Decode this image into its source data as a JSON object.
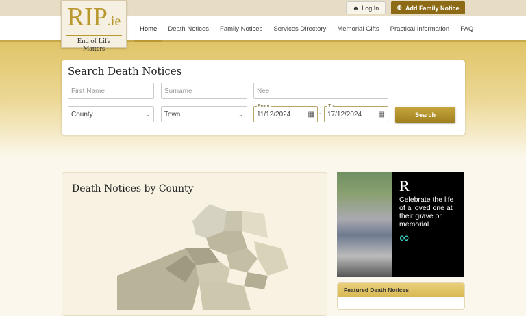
{
  "header": {
    "logo_main": "RIP",
    "logo_suffix": ".ie",
    "logo_tagline": "End of Life Matters",
    "login": "Log In",
    "add_notice": "Add Family Notice"
  },
  "nav": [
    "Home",
    "Death Notices",
    "Family Notices",
    "Services Directory",
    "Memorial Gifts",
    "Practical Information",
    "FAQ"
  ],
  "search": {
    "title": "Search Death Notices",
    "first_name_placeholder": "First Name",
    "surname_placeholder": "Surname",
    "nee_placeholder": "Nee",
    "county": "County",
    "town": "Town",
    "from_label": "From",
    "from": "11/12/2024",
    "to_label": "To",
    "to": "17/12/2024",
    "separator": "-",
    "button": "Search"
  },
  "county_section": {
    "title": "Death Notices by County"
  },
  "ad": {
    "logo": "R",
    "text": "Celebrate the life of a loved one at their grave or memorial"
  },
  "featured": {
    "title": "Featured Death Notices"
  },
  "colors": {
    "gold": "#b8982f",
    "brown": "#8c6a16"
  }
}
